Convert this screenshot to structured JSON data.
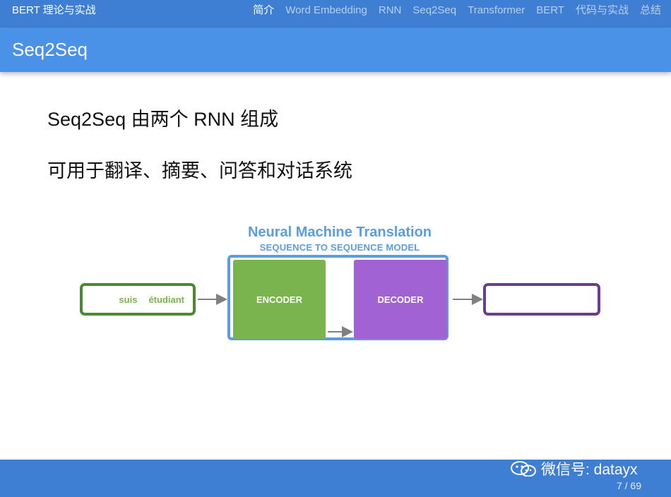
{
  "topbar": {
    "deck_title": "BERT 理论与实战",
    "nav": [
      {
        "label": "简介",
        "active": true
      },
      {
        "label": "Word Embedding",
        "active": false
      },
      {
        "label": "RNN",
        "active": false
      },
      {
        "label": "Seq2Seq",
        "active": false
      },
      {
        "label": "Transformer",
        "active": false
      },
      {
        "label": "BERT",
        "active": false
      },
      {
        "label": "代码与实战",
        "active": false
      },
      {
        "label": "总结",
        "active": false
      }
    ]
  },
  "header": {
    "title": "Seq2Seq"
  },
  "content": {
    "bullets": [
      "Seq2Seq 由两个 RNN 组成",
      "可用于翻译、摘要、问答和对话系统"
    ]
  },
  "diagram": {
    "title": "Neural Machine Translation",
    "subtitle": "SEQUENCE TO SEQUENCE MODEL",
    "input_words": [
      "suis",
      "étudiant"
    ],
    "encoder_label": "ENCODER",
    "decoder_label": "DECODER",
    "colors": {
      "accent_blue": "#5a9de0",
      "encoder_green": "#7ab44f",
      "input_border": "#4c8a2e",
      "decoder_purple": "#a163d4",
      "output_border": "#6b3d8f",
      "arrow_gray": "#808080"
    }
  },
  "footer": {
    "wechat_icon": "wechat-icon",
    "wechat_text": "微信号: datayx",
    "page": "7 / 69"
  },
  "colors": {
    "topbar": "#3f7fd3",
    "header": "#4a91e8"
  }
}
